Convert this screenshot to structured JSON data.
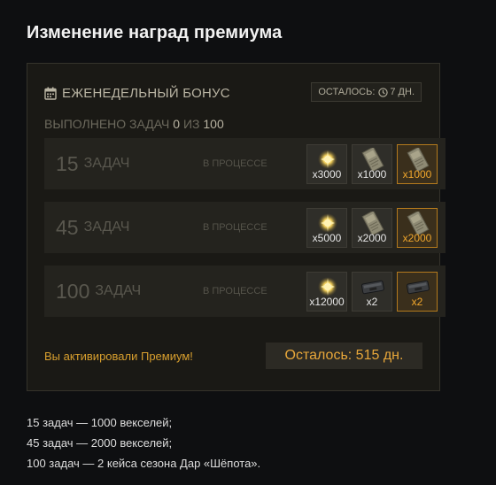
{
  "page_title": "Изменение наград премиума",
  "panel": {
    "title": "ЕЖЕНЕДЕЛЬНЫЙ БОНУС",
    "remaining_label": "ОСТАЛОСЬ:",
    "remaining_value": "7 дн.",
    "progress_prefix": "ВЫПОЛНЕНО ЗАДАЧ",
    "progress_done": "0",
    "progress_sep": "ИЗ",
    "progress_total": "100",
    "icons": {
      "header": "calendar-icon",
      "timer": "clock-icon"
    },
    "tiers": [
      {
        "count": "15",
        "count_label": "ЗАДАЧ",
        "status": "В ПРОЦЕССЕ",
        "rewards": [
          {
            "icon": "coins-icon",
            "qty": "x3000",
            "highlight": false
          },
          {
            "icon": "note-bill-icon",
            "qty": "x1000",
            "highlight": false
          },
          {
            "icon": "note-bill-icon",
            "qty": "x1000",
            "highlight": true
          }
        ]
      },
      {
        "count": "45",
        "count_label": "ЗАДАЧ",
        "status": "В ПРОЦЕССЕ",
        "rewards": [
          {
            "icon": "coins-icon",
            "qty": "x5000",
            "highlight": false
          },
          {
            "icon": "note-bill-icon",
            "qty": "x2000",
            "highlight": false
          },
          {
            "icon": "note-bill-icon",
            "qty": "x2000",
            "highlight": true
          }
        ]
      },
      {
        "count": "100",
        "count_label": "ЗАДАЧ",
        "status": "В ПРОЦЕССЕ",
        "rewards": [
          {
            "icon": "coins-icon",
            "qty": "x12000",
            "highlight": false
          },
          {
            "icon": "case-icon",
            "qty": "x2",
            "highlight": false
          },
          {
            "icon": "case-icon",
            "qty": "x2",
            "highlight": true
          }
        ]
      }
    ],
    "premium_activated": "Вы активировали Премиум!",
    "premium_remaining": "Осталось: 515 дн.",
    "colors": {
      "accent": "#d89f2e",
      "highlight_border": "#b47a1d",
      "panel_bg": "#1a1915"
    }
  },
  "notes": [
    "15 задач — 1000 векселей;",
    "45 задач — 2000 векселей;",
    "100 задач — 2 кейса сезона Дар «Шёпота»."
  ]
}
